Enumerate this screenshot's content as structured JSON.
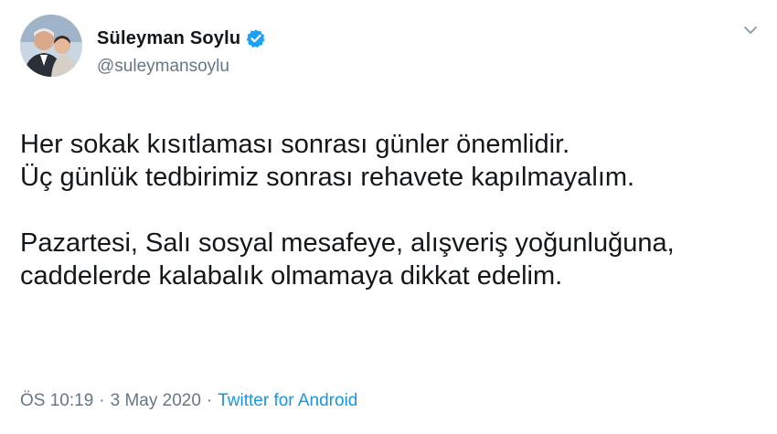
{
  "author": {
    "display_name": "Süleyman Soylu",
    "handle": "@suleymansoylu",
    "verified": true,
    "avatar_icon": "profile-photo"
  },
  "tweet": {
    "lines": [
      "Her sokak kısıtlaması sonrası günler önemlidir.",
      "Üç günlük tedbirimiz sonrası rehavete kapılmayalım.",
      "",
      "Pazartesi, Salı sosyal mesafeye, alışveriş yoğunluğuna,",
      "caddelerde kalabalık olmamaya dikkat edelim."
    ]
  },
  "meta": {
    "time": "ÖS 10:19",
    "separator": "·",
    "date": "3 May 2020",
    "source": "Twitter for Android"
  },
  "colors": {
    "verified": "#1da1f2",
    "secondary_text": "#657786",
    "link": "#1b95e0",
    "primary_text": "#14171a"
  },
  "icons": {
    "verified": "verified-badge-icon",
    "menu": "chevron-down-icon"
  }
}
